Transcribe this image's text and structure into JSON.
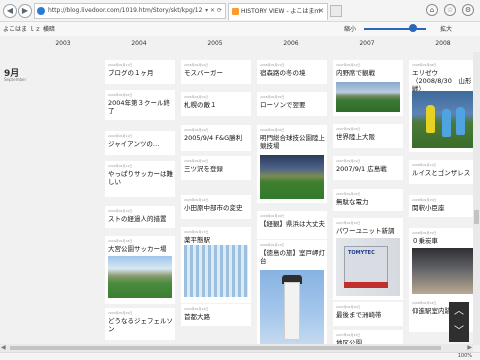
{
  "browser": {
    "url": "http://blog.livedoor.com/1019.htm/Story/skt/kpg/12",
    "tab_title": "HISTORY VIEW - よこはまｍ",
    "zoom_status": "100%",
    "nav_back_glyph": "◀",
    "nav_forward_glyph": "▶",
    "url_tools_glyph": "▾ ✕ ⟳",
    "tab_close_glyph": "✕",
    "home_icon_glyph": "⌂",
    "star_icon_glyph": "☆",
    "settings_icon_glyph": "⚙"
  },
  "site": {
    "title": "よこはま ｌｚ 横暗",
    "zoom_low": "縮小",
    "zoom_high": "拡大"
  },
  "years": [
    "2003",
    "2004",
    "2005",
    "2006",
    "2007",
    "2008"
  ],
  "month": {
    "label": "9月",
    "sub": "September"
  },
  "columns": [
    [
      {
        "date": "2004年09月11日",
        "title": "ブログの１ヶ月"
      },
      {
        "date": "2004年09月05日",
        "title": "2004年第３クール終了"
      },
      {
        "date": "2004年09月11日",
        "title": "ジャイアンツの…"
      },
      {
        "date": "2004年09月11日",
        "title": "やっぱりサッカーは難しい"
      },
      {
        "date": "2004年09月15日",
        "title": "ストの経過人的措置"
      },
      {
        "date": "2004年09月18日",
        "title": "大宮公園サッカー場"
      },
      {
        "date": "2004年09月25日",
        "title": "どうなるジェフェルソン"
      }
    ],
    [
      {
        "date": "2005年09月01日",
        "title": "モスバーガー"
      },
      {
        "date": "2005年09月02日",
        "title": "札幌の敵１"
      },
      {
        "date": "2005年09月04日",
        "title": "2005/9/4 F&G勝利"
      },
      {
        "date": "2005年09月10日",
        "title": "三ツ沢を登録"
      },
      {
        "date": "2005年09月12日",
        "title": "小田原中部市の変史"
      },
      {
        "date": "2005年09月17日",
        "title": "薬平態駅"
      },
      {
        "date": "2005年09月24日",
        "title": "首都大路"
      }
    ],
    [
      {
        "date": "2006年09月01日",
        "title": "宿森路の冬の境"
      },
      {
        "date": "2006年09月05日",
        "title": "ローソンで翌要"
      },
      {
        "date": "2006年09月09日",
        "title": "明門総合球技公園陸上競技場"
      },
      {
        "date": "2006年09月16日",
        "title": "【経観】県浜は大丈夫"
      },
      {
        "date": "2006年09月17日",
        "title": "【徳島の旅】室戸岬灯台"
      }
    ],
    [
      {
        "date": "2007年09月01日",
        "title": "内野席で観戦"
      },
      {
        "date": "2007年09月03日",
        "title": "世界陸上大阪"
      },
      {
        "date": "2007年09月01日",
        "title": "2007/9/1 広島戦"
      },
      {
        "date": "2007年09月05日",
        "title": "無駄な電力"
      },
      {
        "date": "2007年09月10日",
        "title": "パワーユニット新調"
      },
      {
        "date": "2007年09月20日",
        "title": "最後まで洲崎帯"
      },
      {
        "date": "2007年09月25日",
        "title": "地区公園"
      }
    ],
    [
      {
        "date": "2008年09月08日",
        "title": "エリゼウ（2008/8/30　山形戦）"
      },
      {
        "date": "2008年09月11日",
        "title": "ルイスとゴンザレス"
      },
      {
        "date": "2008年09月15日",
        "title": "関釈小臣座"
      },
      {
        "date": "2008年09月15日",
        "title": "０乗炭車"
      },
      {
        "date": "2008年09月24日",
        "title": "仰進駅室内跡度"
      }
    ]
  ],
  "float_buttons": {
    "up": "︿",
    "down": "﹀"
  },
  "scroll": {
    "left": "◀",
    "right": "▶"
  }
}
